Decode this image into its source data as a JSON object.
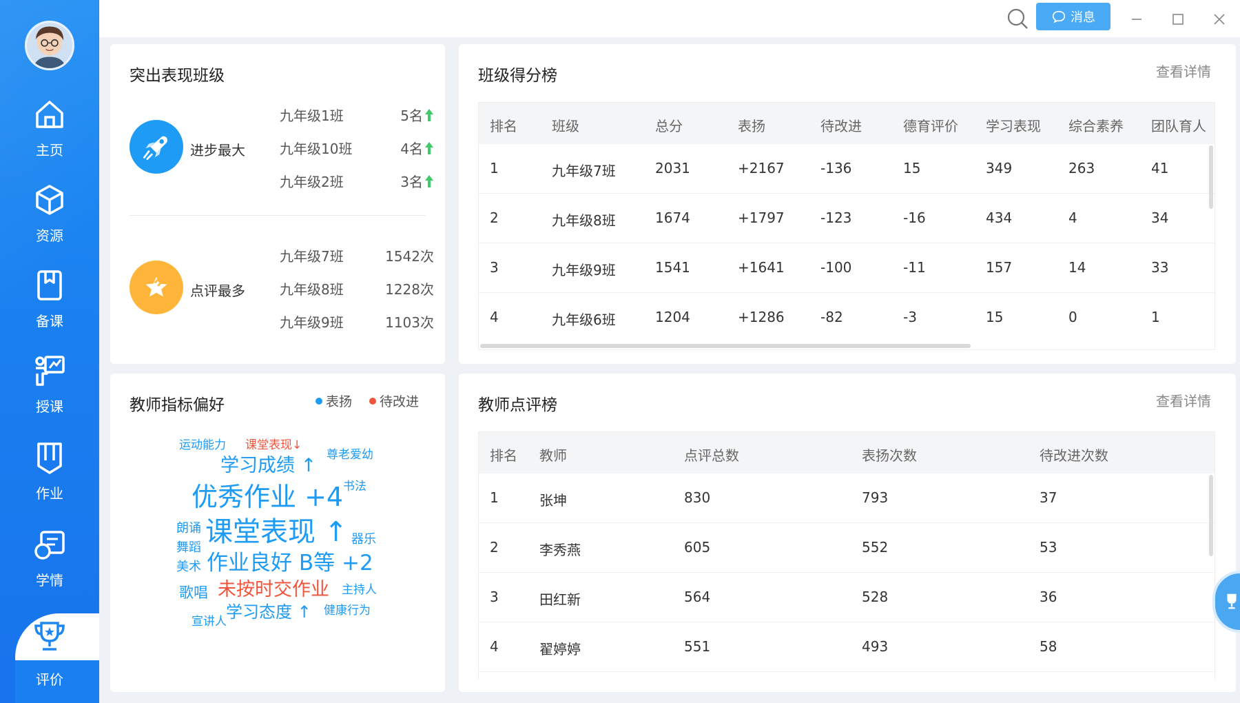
{
  "sidebar": {
    "items": [
      {
        "label": "主页",
        "icon": "home-icon"
      },
      {
        "label": "资源",
        "icon": "cube-icon"
      },
      {
        "label": "备课",
        "icon": "book-icon"
      },
      {
        "label": "授课",
        "icon": "teach-icon"
      },
      {
        "label": "作业",
        "icon": "homework-icon"
      },
      {
        "label": "学情",
        "icon": "analytics-icon"
      },
      {
        "label": "评价",
        "icon": "trophy-icon"
      }
    ],
    "active": "评价"
  },
  "titlebar": {
    "message_label": "消息"
  },
  "outstanding": {
    "title": "突出表现班级",
    "progress": {
      "label": "进步最大",
      "rows": [
        {
          "class": "九年级1班",
          "value": "5名"
        },
        {
          "class": "九年级10班",
          "value": "4名"
        },
        {
          "class": "九年级2班",
          "value": "3名"
        }
      ]
    },
    "comments": {
      "label": "点评最多",
      "rows": [
        {
          "class": "九年级7班",
          "value": "1542次"
        },
        {
          "class": "九年级8班",
          "value": "1228次"
        },
        {
          "class": "九年级9班",
          "value": "1103次"
        }
      ]
    },
    "colors": {
      "progress": "#1e9bf4",
      "comments": "#ffb53a",
      "arrow": "#3ec96b"
    }
  },
  "class_rank": {
    "title": "班级得分榜",
    "detail_link": "查看详情",
    "headers": [
      "排名",
      "班级",
      "总分",
      "表扬",
      "待改进",
      "德育评价",
      "学习表现",
      "综合素养",
      "团队育人"
    ],
    "rows": [
      [
        "1",
        "九年级7班",
        "2031",
        "+2167",
        "-136",
        "15",
        "349",
        "263",
        "41"
      ],
      [
        "2",
        "九年级8班",
        "1674",
        "+1797",
        "-123",
        "-16",
        "434",
        "4",
        "34"
      ],
      [
        "3",
        "九年级9班",
        "1541",
        "+1641",
        "-100",
        "-11",
        "157",
        "14",
        "33"
      ],
      [
        "4",
        "九年级6班",
        "1204",
        "+1286",
        "-82",
        "-3",
        "15",
        "0",
        "1"
      ]
    ]
  },
  "teacher_pref": {
    "title": "教师指标偏好",
    "legend": [
      {
        "label": "表扬",
        "color": "#1e9bf4"
      },
      {
        "label": "待改进",
        "color": "#f0553c"
      }
    ],
    "words": [
      {
        "text": "运动能力",
        "type": "praise"
      },
      {
        "text": "课堂表现↓",
        "type": "improve"
      },
      {
        "text": "尊老爱幼",
        "type": "praise"
      },
      {
        "text": "学习成绩 ↑",
        "type": "praise"
      },
      {
        "text": "优秀作业 +4",
        "type": "praise"
      },
      {
        "text": "书法",
        "type": "praise"
      },
      {
        "text": "朗诵",
        "type": "praise"
      },
      {
        "text": "课堂表现 ↑",
        "type": "praise"
      },
      {
        "text": "器乐",
        "type": "praise"
      },
      {
        "text": "舞蹈",
        "type": "praise"
      },
      {
        "text": "美术",
        "type": "praise"
      },
      {
        "text": "作业良好 B等 +2",
        "type": "praise"
      },
      {
        "text": "歌唱",
        "type": "praise"
      },
      {
        "text": "未按时交作业",
        "type": "improve"
      },
      {
        "text": "主持人",
        "type": "praise"
      },
      {
        "text": "学习态度 ↑",
        "type": "praise"
      },
      {
        "text": "宣讲人",
        "type": "praise"
      },
      {
        "text": "健康行为",
        "type": "praise"
      }
    ]
  },
  "teacher_rank": {
    "title": "教师点评榜",
    "detail_link": "查看详情",
    "headers": [
      "排名",
      "教师",
      "点评总数",
      "表扬次数",
      "待改进次数"
    ],
    "rows": [
      [
        "1",
        "张坤",
        "830",
        "793",
        "37"
      ],
      [
        "2",
        "李秀燕",
        "605",
        "552",
        "53"
      ],
      [
        "3",
        "田红新",
        "564",
        "528",
        "36"
      ],
      [
        "4",
        "翟婷婷",
        "551",
        "493",
        "58"
      ]
    ]
  }
}
